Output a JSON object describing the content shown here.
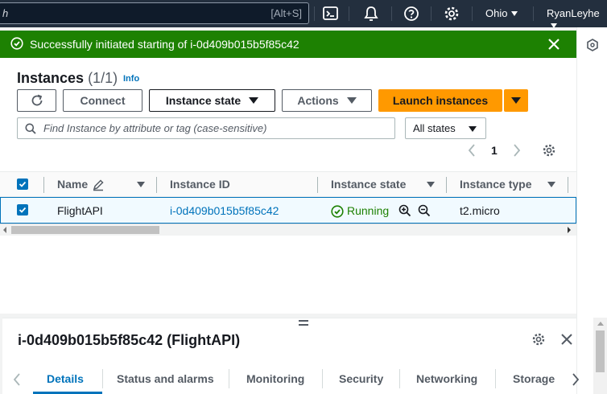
{
  "topbar": {
    "search_text": "h",
    "search_shortcut": "[Alt+S]",
    "icons": [
      "cloudshell-icon",
      "notifications-icon",
      "help-icon",
      "settings-icon"
    ],
    "region": "Ohio",
    "account": "RyanLeyhe"
  },
  "flash": {
    "message": "Successfully initiated starting of i-0d409b015b5f85c42",
    "color": "#1d8102"
  },
  "instances": {
    "title": "Instances",
    "count": "(1/1)",
    "info": "Info",
    "buttons": {
      "refresh": "refresh-icon",
      "connect": "Connect",
      "instance_state": "Instance state",
      "actions": "Actions",
      "launch": "Launch instances"
    },
    "filter_placeholder": "Find Instance by attribute or tag (case-sensitive)",
    "states_filter": "All states",
    "page": "1",
    "columns": [
      "Name",
      "Instance ID",
      "Instance state",
      "Instance type"
    ],
    "rows": [
      {
        "name": "FlightAPI",
        "instance_id": "i-0d409b015b5f85c42",
        "state": "Running",
        "type": "t2.micro",
        "selected": true
      }
    ]
  },
  "details": {
    "title": "i-0d409b015b5f85c42 (FlightAPI)",
    "tabs": [
      "Details",
      "Status and alarms",
      "Monitoring",
      "Security",
      "Networking",
      "Storage"
    ],
    "active_tab": "Details"
  },
  "colors": {
    "accent": "#0073bb",
    "primary_button": "#ff9900",
    "success": "#1d8102",
    "nav_bg": "#232f3e"
  }
}
